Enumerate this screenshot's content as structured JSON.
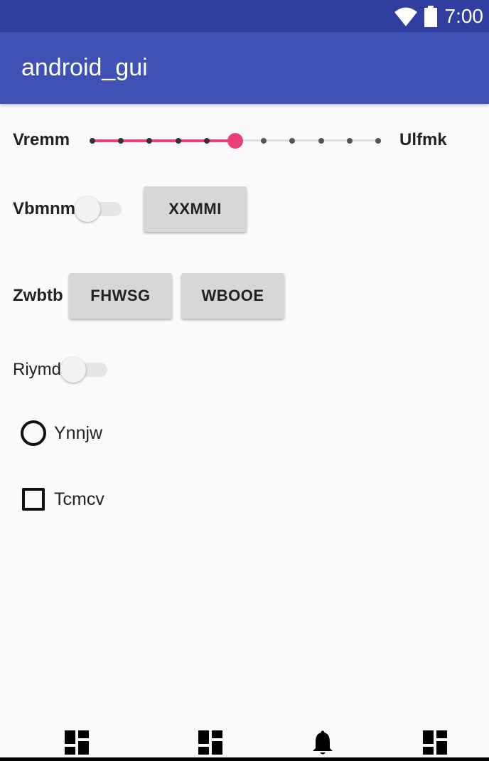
{
  "status_bar": {
    "time": "7:00",
    "icons": [
      "wifi-icon",
      "battery-icon"
    ]
  },
  "app_bar": {
    "title": "android_gui"
  },
  "seekbar_row": {
    "start_label": "Vremm",
    "end_label": "Ulfmk",
    "tick_count": 11,
    "selected_index": 5,
    "accent_color": "#ec407a"
  },
  "switch_row_1": {
    "label": "Vbmnm",
    "checked": false,
    "button_label": "XXMMI"
  },
  "button_row": {
    "label": "Zwbtb",
    "button_1_label": "FHWSG",
    "button_2_label": "WBOOE"
  },
  "switch_row_2": {
    "label": "Riymd",
    "checked": false
  },
  "radio_option": {
    "label": "Ynnjw",
    "checked": false
  },
  "checkbox_option": {
    "label": "Tcmcv",
    "checked": false
  },
  "bottom_nav": {
    "items": [
      "dashboard-icon",
      "dashboard-icon",
      "notifications-icon",
      "dashboard-icon"
    ]
  },
  "colors": {
    "status_bar": "#303f9f",
    "app_bar": "#3f51b5",
    "background": "#fafafa",
    "button": "#d6d7d7"
  }
}
